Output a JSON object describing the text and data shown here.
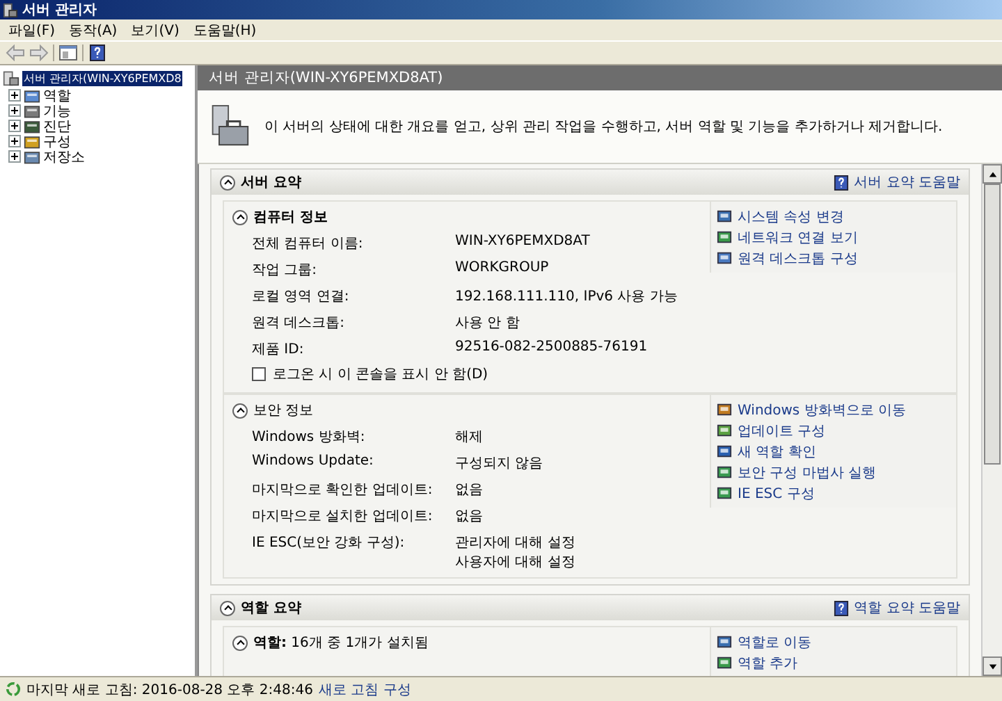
{
  "window": {
    "title": "서버 관리자"
  },
  "menu": [
    "파일(F)",
    "동작(A)",
    "보기(V)",
    "도움말(H)"
  ],
  "tree": {
    "label": "서버 관리자(WIN-XY6PEMXD8",
    "selected": true,
    "children": [
      {
        "label": "역할",
        "kind": "roles",
        "expanded": false
      },
      {
        "label": "기능",
        "kind": "features",
        "expanded": false
      },
      {
        "label": "진단",
        "kind": "diagnostics",
        "expanded": false
      },
      {
        "label": "구성",
        "kind": "config",
        "expanded": false
      },
      {
        "label": "저장소",
        "kind": "storage",
        "expanded": false
      }
    ]
  },
  "pane": {
    "title": "서버 관리자(WIN-XY6PEMXD8AT)",
    "description": "이 서버의 상태에 대한 개요를 얻고, 상위 관리 작업을 수행하고, 서버 역할 및 기능을 추가하거나 제거합니다."
  },
  "sections": [
    {
      "title": "서버 요약",
      "help_link": "서버 요약 도움말",
      "expanded": true,
      "groups": [
        {
          "title": "컴퓨터 정보",
          "expanded": true,
          "rows": [
            {
              "label": "전체 컴퓨터 이름:",
              "value": [
                "WIN-XY6PEMXD8AT"
              ]
            },
            {
              "label": "작업 그룹:",
              "value": [
                "WORKGROUP"
              ]
            },
            {
              "label": "로컬 영역 연결:",
              "value": [
                "192.168.111.110, IPv6 사용 가능"
              ]
            },
            {
              "label": "원격 데스크톱:",
              "value": [
                "사용 안 함"
              ]
            },
            {
              "label": "제품 ID:",
              "value": [
                "92516-082-2500885-76191"
              ]
            }
          ],
          "checkbox": {
            "label": "로그온 시 이 콘솔을 표시 안 함(D)",
            "checked": false
          },
          "links": [
            {
              "label": "시스템 속성 변경",
              "kind": "system"
            },
            {
              "label": "네트워크 연결 보기",
              "kind": "network"
            },
            {
              "label": "원격 데스크톱 구성",
              "kind": "remote"
            }
          ]
        },
        {
          "title": "보안 정보",
          "expanded": true,
          "rows": [
            {
              "label": "Windows 방화벽:",
              "value": [
                "해제"
              ]
            },
            {
              "label": "Windows Update:",
              "value": [
                "구성되지 않음"
              ]
            },
            {
              "label": "마지막으로 확인한 업데이트:",
              "value": [
                "없음"
              ]
            },
            {
              "label": "마지막으로 설치한 업데이트:",
              "value": [
                "없음"
              ]
            },
            {
              "label": "IE ESC(보안 강화 구성):",
              "value": [
                "관리자에 대해 설정",
                "사용자에 대해 설정"
              ]
            }
          ],
          "links": [
            {
              "label": "Windows 방화벽으로 이동",
              "kind": "firewall"
            },
            {
              "label": "업데이트 구성",
              "kind": "update"
            },
            {
              "label": "새 역할 확인",
              "kind": "refresh"
            },
            {
              "label": "보안 구성 마법사 실행",
              "kind": "wizard"
            },
            {
              "label": "IE ESC 구성",
              "kind": "wizard"
            }
          ]
        }
      ]
    },
    {
      "title": "역할 요약",
      "help_link": "역할 요약 도움말",
      "expanded": true,
      "groups": [
        {
          "title": "**역할:** 16개 중 1개가 설치됨",
          "expanded": true,
          "links": [
            {
              "label": "역할로 이동",
              "kind": "system"
            },
            {
              "label": "역할 추가",
              "kind": "network"
            }
          ]
        }
      ]
    }
  ],
  "status": {
    "text": "마지막 새로 고침: 2016-08-28 오후 2:48:46",
    "link": "새로 고침 구성"
  }
}
